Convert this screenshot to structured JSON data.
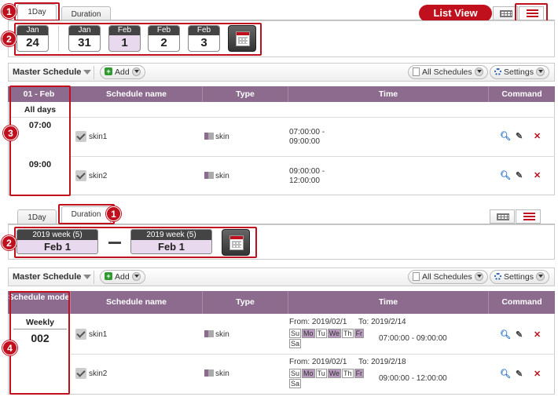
{
  "top": {
    "tabs": [
      "1Day",
      "Duration"
    ],
    "list_view_label": "List View",
    "dates": [
      {
        "month": "Jan",
        "day": "24"
      },
      {
        "month": "Jan",
        "day": "31"
      },
      {
        "month": "Feb",
        "day": "1"
      },
      {
        "month": "Feb",
        "day": "2"
      },
      {
        "month": "Feb",
        "day": "3"
      }
    ],
    "toolbar": {
      "master": "Master Schedule",
      "add": "Add",
      "all": "All Schedules",
      "settings": "Settings"
    },
    "columns": [
      "01 - Feb",
      "Schedule name",
      "Type",
      "Time",
      "Command"
    ],
    "sidebar": {
      "all_days": "All days",
      "times": [
        "07:00",
        "09:00"
      ]
    },
    "rows": [
      {
        "name": "skin1",
        "type": "skin",
        "time1": "07:00:00 -",
        "time2": "09:00:00"
      },
      {
        "name": "skin2",
        "type": "skin",
        "time1": "09:00:00 -",
        "time2": "12:00:00"
      }
    ]
  },
  "bottom": {
    "tabs": [
      "1Day",
      "Duration"
    ],
    "weeks": [
      {
        "label": "2019 week (5)",
        "day": "Feb 1"
      },
      {
        "label": "2019 week (5)",
        "day": "Feb 1"
      }
    ],
    "toolbar": {
      "master": "Master Schedule",
      "add": "Add",
      "all": "All Schedules",
      "settings": "Settings"
    },
    "columns": [
      "Schedule mode",
      "Schedule name",
      "Type",
      "Time",
      "Command"
    ],
    "sidebar": {
      "mode": "Weekly",
      "value": "002"
    },
    "rows": [
      {
        "name": "skin1",
        "type": "skin",
        "from": "From: 2019/02/1",
        "to": "To: 2019/2/14",
        "time": "07:00:00 - 09:00:00"
      },
      {
        "name": "skin2",
        "type": "skin",
        "from": "From: 2019/02/1",
        "to": "To: 2019/2/18",
        "time": "09:00:00 - 12:00:00"
      }
    ],
    "days": [
      {
        "label": "Su",
        "on": false
      },
      {
        "label": "Mo",
        "on": true
      },
      {
        "label": "Tu",
        "on": false
      },
      {
        "label": "We",
        "on": true
      },
      {
        "label": "Th",
        "on": false
      },
      {
        "label": "Fr",
        "on": true
      },
      {
        "label": "Sa",
        "on": false
      }
    ]
  },
  "badges": [
    "1",
    "2",
    "3",
    "1",
    "2",
    "4"
  ],
  "colors": {
    "accent": "#c0101e",
    "header": "#8c6b8f",
    "selected": "#e8d9ef"
  }
}
